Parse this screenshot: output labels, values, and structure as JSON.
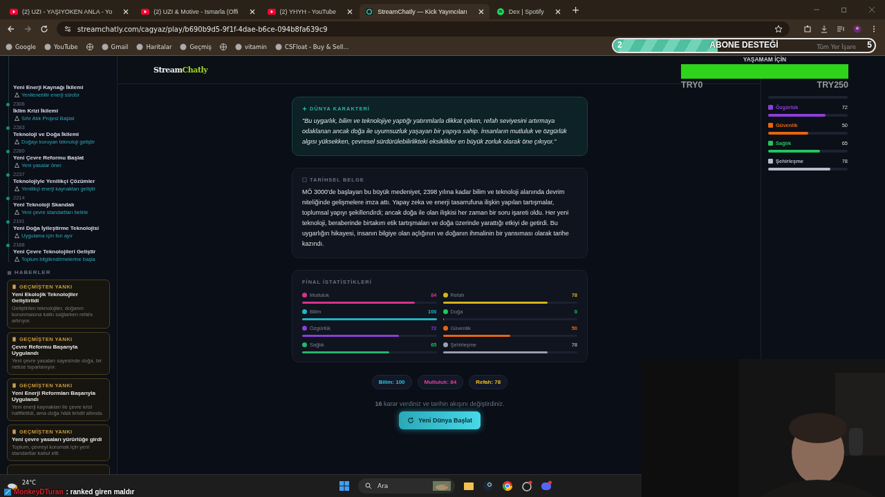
{
  "browser": {
    "tabs": [
      {
        "title": "(2) UZI - YAŞIYOKEN ANLA - Yo",
        "kind": "youtube",
        "selected": false
      },
      {
        "title": "(2) UZI & Motive - Ismarla (Offi",
        "kind": "youtube",
        "selected": false
      },
      {
        "title": "(2) YHYH - YouTube",
        "kind": "youtube",
        "selected": false
      },
      {
        "title": "StreamChatly — Kick Yayıncıları",
        "kind": "chat",
        "selected": true
      },
      {
        "title": "Dex | Spotify",
        "kind": "spotify",
        "selected": false
      }
    ],
    "new_tab": "+",
    "url": "streamchatly.com/cagyaz/play/b690b9d5-9f1f-4dae-b6ce-094b8fa639c9",
    "bookmarks": [
      {
        "kind": "link",
        "label": "Google"
      },
      {
        "kind": "link",
        "label": "YouTube"
      },
      {
        "kind": "globe"
      },
      {
        "kind": "link",
        "label": "Gmail"
      },
      {
        "kind": "link",
        "label": "Haritalar"
      },
      {
        "kind": "link",
        "label": "Geçmiş"
      },
      {
        "kind": "globe"
      },
      {
        "kind": "link",
        "label": "vitamin"
      },
      {
        "kind": "link",
        "label": "CSFloat - Buy & Sell..."
      }
    ],
    "all_bookmarks": "Tüm Yer İşare"
  },
  "overlay_goal": {
    "start": "2",
    "title": "ABONE DESTEĞİ",
    "end": "5",
    "level": 0.4
  },
  "overlay_donation": {
    "title": "YAŞAMAM İÇİN",
    "min": "TRY0",
    "max": "TRY250",
    "level": 1
  },
  "logo": [
    "Stream",
    "Chatly"
  ],
  "timeline": [
    {
      "title": "Yeni Enerji Kaynağı İkilemi",
      "choice": "Yenilenebilir enerji sürdür"
    },
    {
      "year": "2306",
      "title": "İklim Krizi İkilemi",
      "choice": "Sıfır Atık Projesi Başlat"
    },
    {
      "year": "2283",
      "title": "Teknoloji ve Doğa İkilemi",
      "choice": "Doğayı koruyan teknoloji geliştir"
    },
    {
      "year": "2260",
      "title": "Yeni Çevre Reformu Başlat",
      "choice": "Yeni yasalar öner"
    },
    {
      "year": "2237",
      "title": "Teknolojiyle Yenilikçi Çözümler",
      "choice": "Yenilikçi enerji kaynakları geliştir"
    },
    {
      "year": "2214",
      "title": "Yeni Teknoloji Skandalı",
      "choice": "Yeni çevre standartları belirle"
    },
    {
      "year": "2191",
      "title": "Yeni Doğa İyileştirme Teknolojisi",
      "choice": "Uygulama için fon ayır"
    },
    {
      "year": "2168",
      "title": "Yeni Çevre Teknolojileri Geliştir",
      "choice": "Toplum bilgilendirmelerine başla"
    }
  ],
  "news": {
    "heading": "HABERLER",
    "items": [
      {
        "tag": "GEÇMİŞTEN YANKI",
        "title": "Yeni Ekolojik Teknolojiler Geliştirildi",
        "text": "Geliştirilen teknolojiler, doğanın korunmasına katkı sağlarken refahı artırıyor."
      },
      {
        "tag": "GEÇMİŞTEN YANKI",
        "title": "Çevre Reformu Başarıyla Uygulandı",
        "text": "Yeni çevre yasaları sayesinde doğa, bir nebze toparlanıyor."
      },
      {
        "tag": "GEÇMİŞTEN YANKI",
        "title": "Yeni Enerji Reformları Başarıyla Uygulandı",
        "text": "Yeni enerji kaynakları ile çevre krizi hafifletildi, ama doğa hâlâ tehdit altında."
      },
      {
        "tag": "GEÇMİŞTEN YANKI",
        "title": "Yeni çevre yasaları yürürlüğe girdi",
        "text": "Toplum, çevreyi korumak için yeni standartlar kabul etti."
      }
    ]
  },
  "character": {
    "heading": "DÜNYA KARAKTERİ",
    "text": "\"Bu uygarlık, bilim ve teknolojiye yaptığı yatırımlarla dikkat çeken, refah seviyesini artırmaya odaklanan ancak doğa ile uyumsuzluk yaşayan bir yapıya sahip. İnsanların mutluluk ve özgürlük algısı yüksekken, çevresel sürdürülebilirlikteki eksiklikler en büyük zorluk olarak öne çıkıyor.\""
  },
  "history": {
    "heading": "TARİHSEL BELGE",
    "text": "MÖ 3000'de başlayan bu büyük medeniyet, 2398 yılına kadar bilim ve teknoloji alanında devrim niteliğinde gelişmelere imza attı. Yapay zeka ve enerji tasarrufuna ilişkin yapılan tartışmalar, toplumsal yapıyı şekillendirdi; ancak doğa ile olan ilişkisi her zaman bir soru işareti oldu. Her yeni teknoloji, beraberinde birtakım etik tartışmaları ve doğa üzerinde yarattığı etkiyi de getirdi. Bu uygarlığın hikayesi, insanın bilgiye olan açlığının ve doğanın ihmalinin bir yansıması olarak tarihe kazındı."
  },
  "final_stats": {
    "heading": "FİNAL İSTATİSTİKLERİ",
    "items": [
      {
        "name": "Mutluluk",
        "value": "84",
        "level": 0.84,
        "color": "#d6338a"
      },
      {
        "name": "Refah",
        "value": "78",
        "level": 0.78,
        "color": "#d4b41c"
      },
      {
        "name": "Bilim",
        "value": "100",
        "level": 1,
        "color": "#1fb5c4"
      },
      {
        "name": "Doğa",
        "value": "0",
        "level": 0,
        "color": "#22c55e"
      },
      {
        "name": "Özgürlük",
        "value": "72",
        "level": 0.72,
        "color": "#8b3fd9"
      },
      {
        "name": "Güvenlik",
        "value": "50",
        "level": 0.5,
        "color": "#e8650f"
      },
      {
        "name": "Sağlık",
        "value": "65",
        "level": 0.65,
        "color": "#22b86a"
      },
      {
        "name": "Şehirleşme",
        "value": "78",
        "level": 0.78,
        "color": "#9aa0ae"
      }
    ]
  },
  "chips": [
    {
      "text": "Bilim: 100",
      "color": "#2cc6e0"
    },
    {
      "text": "Mutluluk: 84",
      "color": "#e040a0"
    },
    {
      "text": "Refah: 78",
      "color": "#f0c020"
    }
  ],
  "summary": "**16** karar verdiniz ve tarihin akışını değiştirdiniz.",
  "restart_button": "Yeni Dünya Başlat",
  "side_stats": [
    {
      "name": "Özgürlük",
      "value": "72",
      "level": 0.72,
      "color": "#8b3fd9"
    },
    {
      "name": "Güvenlik",
      "value": "50",
      "level": 0.5,
      "color": "#e8650f"
    },
    {
      "name": "Sağlık",
      "value": "65",
      "level": 0.65,
      "color": "#22c55e"
    },
    {
      "name": "Şehirleşme",
      "value": "78",
      "level": 0.78,
      "color": "#b8bccb"
    }
  ],
  "taskbar": {
    "temperature": "24°C",
    "search": "Ara"
  },
  "chat": {
    "user": "MonkeyDTuran",
    "message": ": ranked giren maldır"
  }
}
